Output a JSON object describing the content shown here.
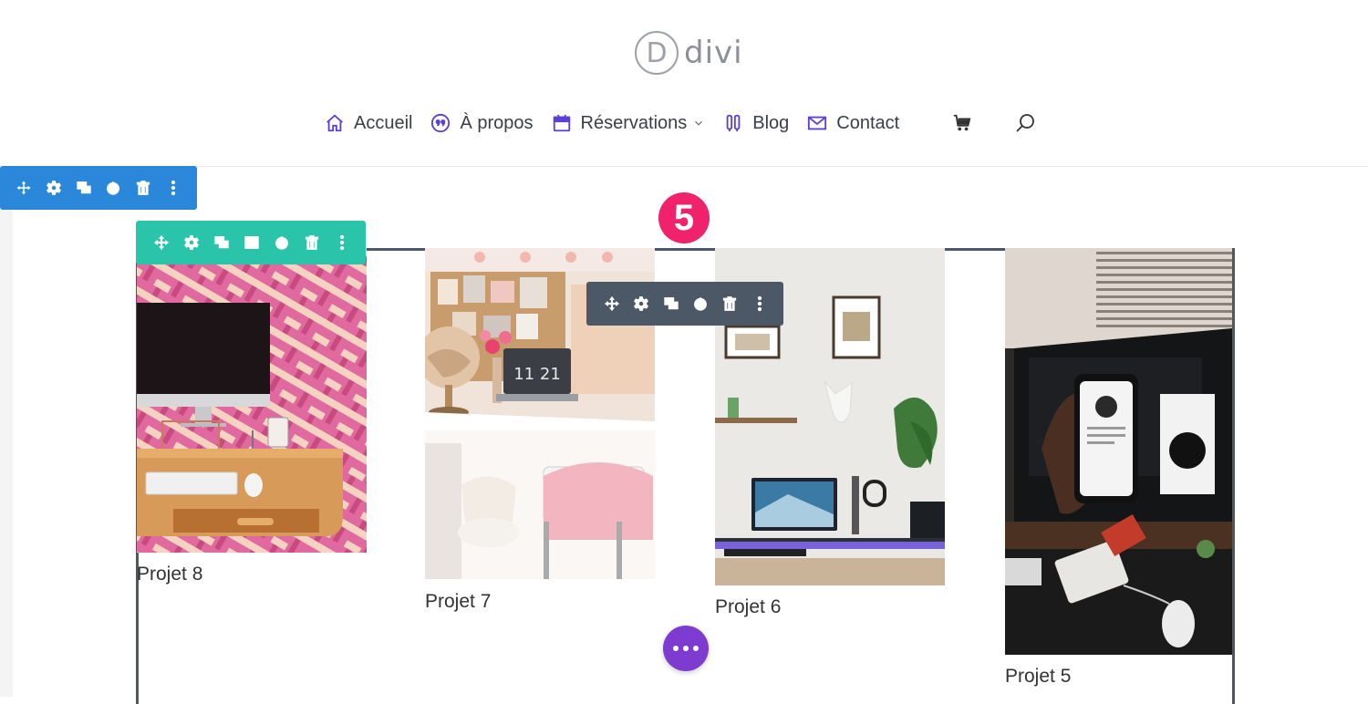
{
  "site": {
    "logo_letter": "D",
    "logo_text": "divi"
  },
  "nav": {
    "items": [
      {
        "label": "Accueil",
        "icon": "home-icon"
      },
      {
        "label": "À propos",
        "icon": "quote-icon"
      },
      {
        "label": "Réservations",
        "icon": "calendar-icon",
        "dropdown": true
      },
      {
        "label": "Blog",
        "icon": "pencil-icon"
      },
      {
        "label": "Contact",
        "icon": "envelope-icon"
      }
    ],
    "cart_icon": "cart-icon",
    "search_icon": "search-icon",
    "icon_color": "#5b3fd6"
  },
  "toolbars": {
    "section": {
      "color": "#2b87da",
      "actions": [
        "move",
        "settings",
        "duplicate",
        "save",
        "delete",
        "more"
      ]
    },
    "row": {
      "color": "#29c4a9",
      "actions": [
        "move",
        "settings",
        "duplicate",
        "columns",
        "save",
        "delete",
        "more"
      ]
    },
    "module": {
      "color": "#4c5866",
      "actions": [
        "move",
        "settings",
        "duplicate",
        "save",
        "delete",
        "more"
      ]
    }
  },
  "step_badge": {
    "number": "5",
    "color": "#f0226b"
  },
  "projects": [
    {
      "caption": "Projet 8"
    },
    {
      "caption": "Projet 7",
      "clock_text": "11 21"
    },
    {
      "caption": "Projet 6"
    },
    {
      "caption": "Projet 5"
    }
  ],
  "add_button": {
    "color": "#7e3bd0",
    "icon": "more-horizontal-icon"
  }
}
